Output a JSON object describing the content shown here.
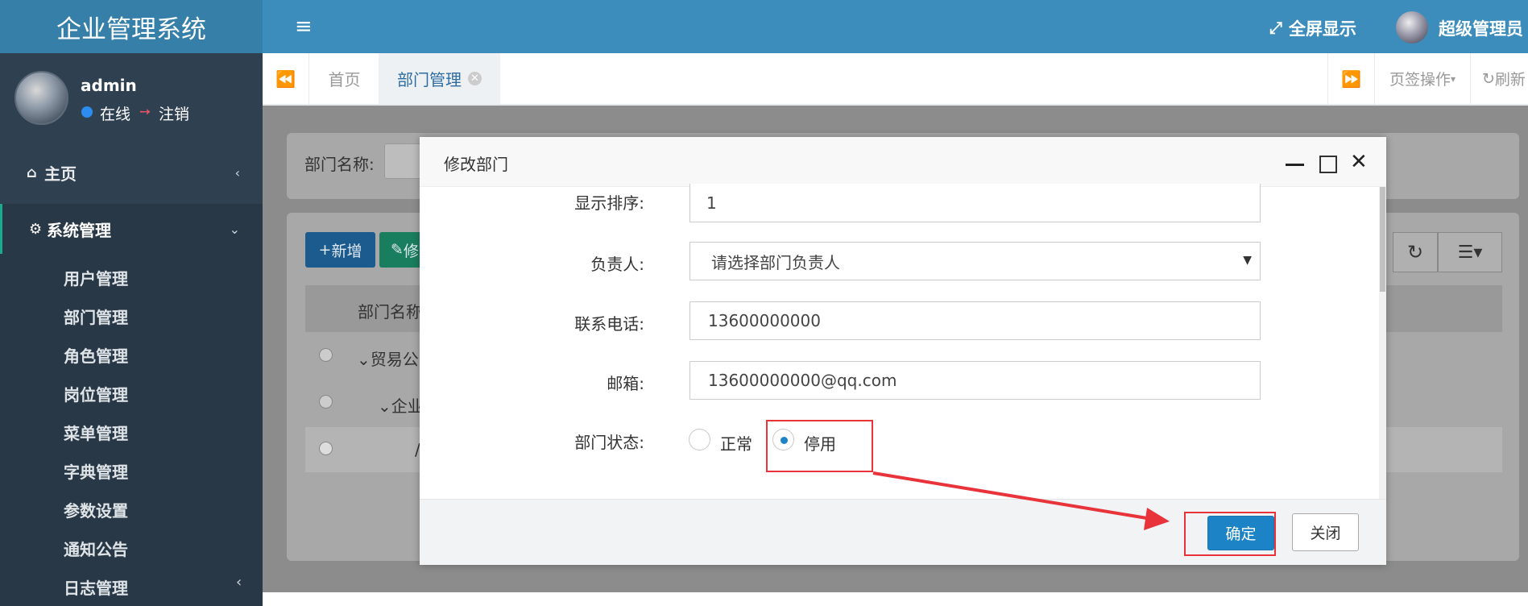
{
  "app": {
    "title": "企业管理系统"
  },
  "user": {
    "name": "admin",
    "status": "在线",
    "logout": "注销"
  },
  "header": {
    "menu_icon": "hamburger-icon",
    "fullscreen": "全屏显示",
    "admin_name": "超级管理员"
  },
  "tabs": {
    "home": "首页",
    "active": "部门管理",
    "ops": "页签操作",
    "refresh": "刷新"
  },
  "sidebar": {
    "home": "主页",
    "system": "系统管理",
    "items": [
      "用户管理",
      "部门管理",
      "角色管理",
      "岗位管理",
      "菜单管理",
      "字典管理",
      "参数设置",
      "通知公告",
      "日志管理"
    ]
  },
  "search": {
    "label": "部门名称:"
  },
  "toolbar": {
    "add": "新增",
    "edit": "修"
  },
  "table": {
    "header": "部门名称",
    "rows": [
      "贸易公",
      "企业",
      "/"
    ]
  },
  "modal": {
    "title": "修改部门",
    "fields": {
      "sort_label": "显示排序:",
      "sort_value": "1",
      "leader_label": "负责人:",
      "leader_placeholder": "请选择部门负责人",
      "phone_label": "联系电话:",
      "phone_value": "13600000000",
      "email_label": "邮箱:",
      "email_value": "13600000000@qq.com",
      "status_label": "部门状态:",
      "status_normal": "正常",
      "status_disabled": "停用",
      "status_selected": "停用"
    },
    "ok": "确定",
    "close": "关闭"
  },
  "colors": {
    "header": "#3c8dbc",
    "sidebar": "#2f4050",
    "primary": "#1c84c6",
    "highlight": "#e8333a"
  }
}
